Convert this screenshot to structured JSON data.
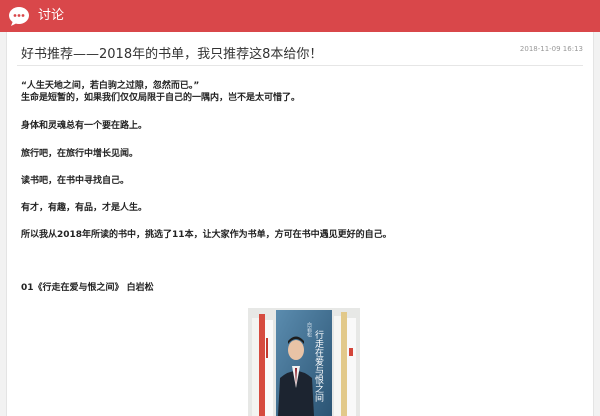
{
  "header": {
    "title": "讨论",
    "accent": "#d9474a",
    "logo_icon": "chat-bubble-icon"
  },
  "post": {
    "title": "好书推荐——2018年的书单，我只推荐这8本给你！",
    "date": "2018-11-09 16:13",
    "paragraphs": [
      "“人生天地之间，若白驹之过隙，忽然而已。”",
      "生命是短暂的，如果我们仅仅局限于自己的一隅内，岂不是太可惜了。",
      "身体和灵魂总有一个要在路上。",
      "旅行吧，在旅行中增长见闻。",
      "读书吧，在书中寻找自己。",
      "有才，有趣，有品，才是人生。",
      "所以我从2018年所读的书中，挑选了11本，让大家作为书单，方可在书中遇见更好的自己。",
      "01《行走在爱与恨之间》 白岩松"
    ],
    "cover_title": "行走在爱与恨之间",
    "cover_author": "白岩松"
  }
}
